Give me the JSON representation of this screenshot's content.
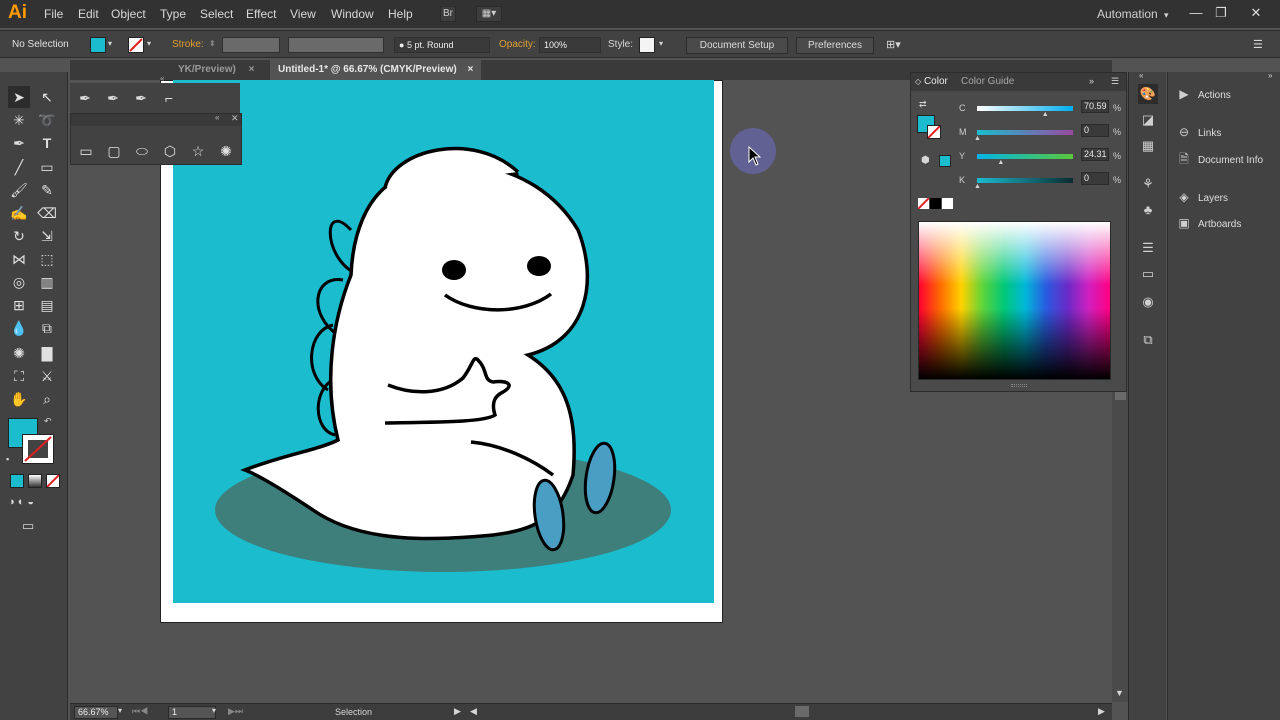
{
  "app": {
    "logo": "Ai"
  },
  "menu": [
    "File",
    "Edit",
    "Object",
    "Type",
    "Select",
    "Effect",
    "View",
    "Window",
    "Help"
  ],
  "workspace": "Automation",
  "window_controls": {
    "minimize": "—",
    "restore": "❐",
    "close": "✕"
  },
  "control_bar": {
    "selection_status": "No Selection",
    "stroke_label": "Stroke:",
    "brush_definition": "5 pt. Round",
    "opacity_label": "Opacity:",
    "opacity_value": "100%",
    "style_label": "Style:",
    "document_setup": "Document Setup",
    "preferences": "Preferences",
    "fill_color": "#1bbcce"
  },
  "tabs": [
    {
      "label": "YK/Preview)",
      "close": "×"
    },
    {
      "label": "Untitled-1* @ 66.67% (CMYK/Preview)",
      "close": "×"
    }
  ],
  "status_bar": {
    "zoom": "66.67%",
    "artboard_number": "1",
    "tool": "Selection"
  },
  "color_panel": {
    "tabs": [
      "Color",
      "Color Guide"
    ],
    "channels": [
      {
        "label": "C",
        "value": "70.59",
        "unit": "%",
        "level": 0.7059
      },
      {
        "label": "M",
        "value": "0",
        "unit": "%",
        "level": 0
      },
      {
        "label": "Y",
        "value": "24.31",
        "unit": "%",
        "level": 0.2431
      },
      {
        "label": "K",
        "value": "0",
        "unit": "%",
        "level": 0
      }
    ],
    "fill_color": "#1bbcce"
  },
  "dock": {
    "items": [
      {
        "label": "Actions",
        "icon": "play-icon"
      },
      {
        "label": "Links",
        "icon": "link-icon"
      },
      {
        "label": "Document Info",
        "icon": "document-info-icon"
      },
      {
        "label": "Layers",
        "icon": "layers-icon"
      },
      {
        "label": "Artboards",
        "icon": "artboards-icon"
      }
    ]
  },
  "artwork": {
    "background_color": "#1bbcce",
    "shadow_color": "#3e7f7b",
    "feet_color": "#4a9ec4"
  }
}
